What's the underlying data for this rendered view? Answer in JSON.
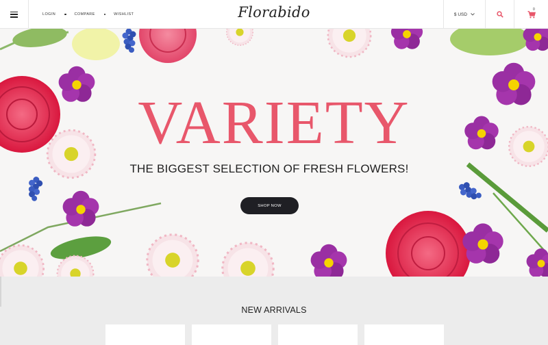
{
  "header": {
    "menu_icon": "hamburger-icon",
    "links": [
      "LOGIN",
      "COMPARE",
      "WISHLIST"
    ],
    "logo": "Florabido",
    "currency": "$ USD",
    "search_icon": "search-icon",
    "cart_icon": "cart-icon",
    "cart_count": "0",
    "accent_color": "#e8576b"
  },
  "hero": {
    "title": "VARIETY",
    "subtitle": "THE BIGGEST SELECTION OF FRESH FLOWERS!",
    "button": "SHOP NOW",
    "title_color": "#e8576b"
  },
  "new_arrivals": {
    "title": "NEW ARRIVALS",
    "card_count": 4
  }
}
